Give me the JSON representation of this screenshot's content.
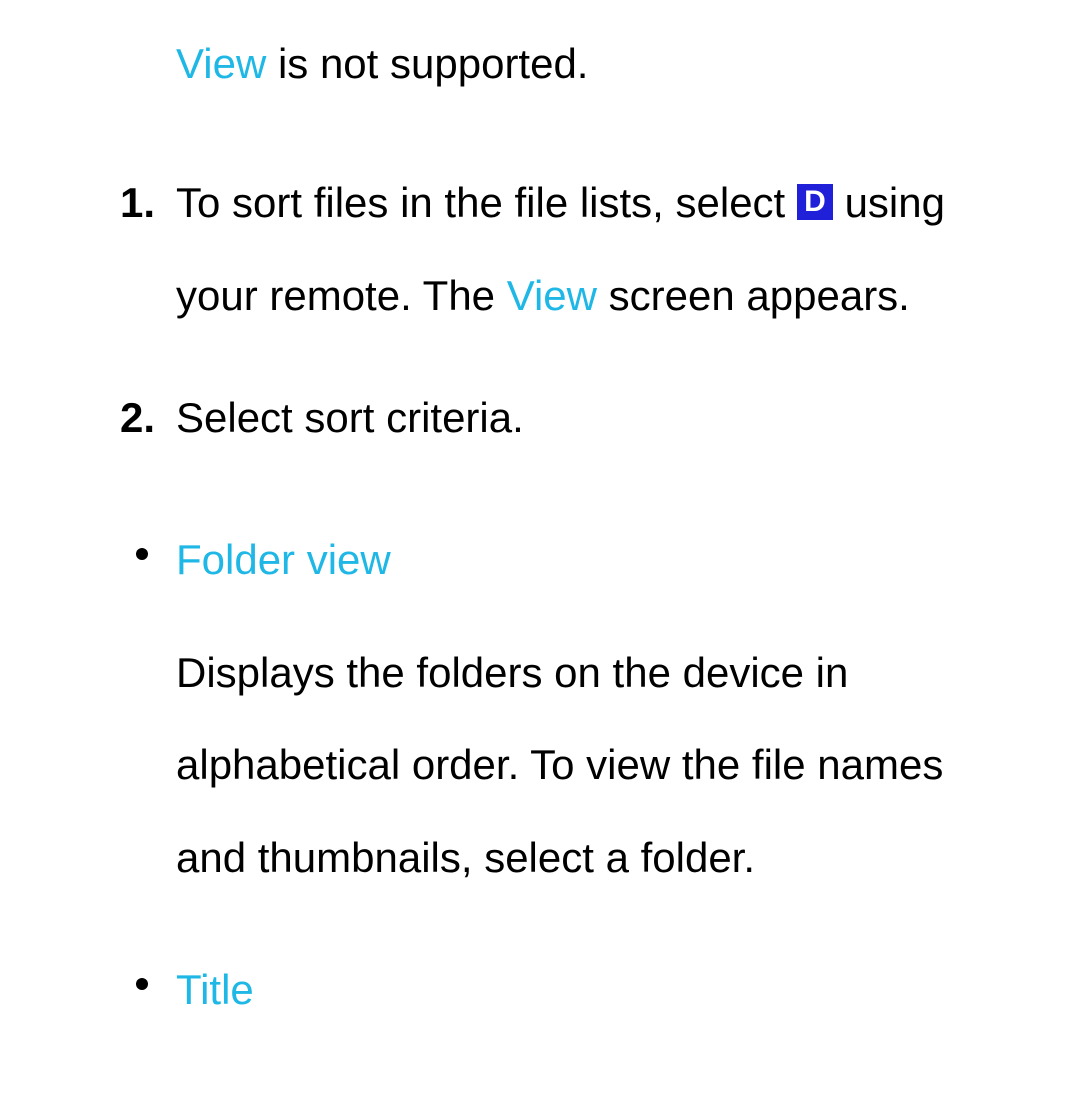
{
  "intro": {
    "highlight": "View",
    "rest": " is not supported."
  },
  "steps": [
    {
      "part1": "To sort files in the file lists, select ",
      "button": "D",
      "part2": " using your remote. The ",
      "highlight": "View",
      "part3": " screen appears."
    },
    {
      "text": "Select sort criteria."
    }
  ],
  "bullets": [
    {
      "title": "Folder view",
      "desc": "Displays the folders on the device in alphabetical order. To view the file names and thumbnails, select a folder."
    },
    {
      "title": "Title",
      "desc": ""
    }
  ]
}
